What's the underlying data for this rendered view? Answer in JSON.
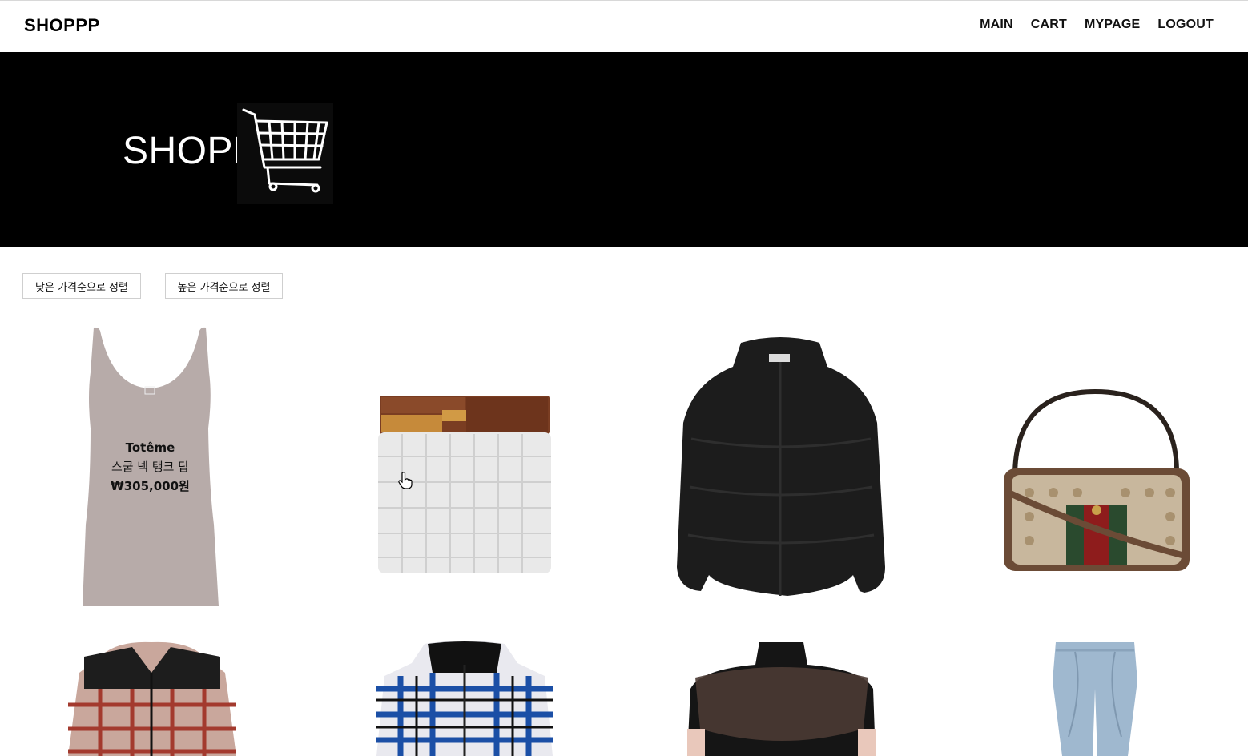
{
  "header": {
    "brand": "SHOPPP",
    "nav": [
      "MAIN",
      "CART",
      "MYPAGE",
      "LOGOUT"
    ]
  },
  "hero": {
    "title": "SHOPP",
    "logo_icon": "shopping-cart-icon"
  },
  "sort": {
    "low_label": "낮은 가격순으로 정렬",
    "high_label": "높은 가격순으로 정렬"
  },
  "products": [
    {
      "brand": "Totême",
      "name": "스쿱 넥 탱크 탑",
      "price": "₩305,000원",
      "image": "tank-top"
    },
    {
      "image": "woven-clutch-bag"
    },
    {
      "image": "puffer-jacket"
    },
    {
      "image": "shoulder-bag"
    },
    {
      "image": "plaid-shirt-jacket"
    },
    {
      "image": "plaid-hooded-shirt"
    },
    {
      "image": "sheer-top"
    },
    {
      "image": "jeans"
    }
  ],
  "colors": {
    "hero_bg": "#000000",
    "tank_top": "#b7aba9",
    "jacket": "#1c1c1c"
  }
}
